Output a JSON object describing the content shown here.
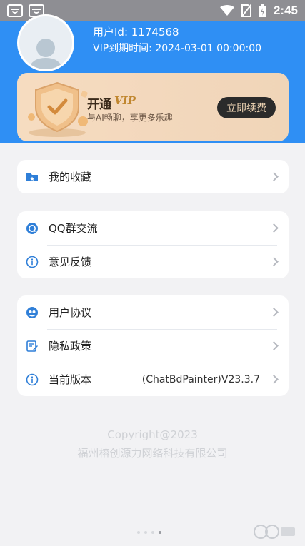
{
  "status_bar": {
    "time": "2:45"
  },
  "user": {
    "id_text": "用户Id: 1174568",
    "vip_expire_text": "VIP到期时间:  2024-03-01 00:00:00"
  },
  "vip_card": {
    "title": "开通",
    "tag": "VIP",
    "subtitle": "与AI畅聊，享更多乐趣",
    "button_label": "立即续费"
  },
  "menu": {
    "group1": [
      {
        "label": "我的收藏",
        "icon": "folder-icon"
      }
    ],
    "group2": [
      {
        "label": "QQ群交流",
        "icon": "qq-icon"
      },
      {
        "label": "意见反馈",
        "icon": "info-icon"
      }
    ],
    "group3": [
      {
        "label": "用户协议",
        "icon": "agreement-icon"
      },
      {
        "label": "隐私政策",
        "icon": "edit-doc-icon"
      },
      {
        "label": "当前版本",
        "icon": "info-icon",
        "value": "(ChatBdPainter)V23.3.7"
      }
    ]
  },
  "footer": {
    "copyright": "Copyright@2023",
    "company": "福州榕创源力网络科技有限公司"
  },
  "colors": {
    "header_blue": "#2f8ff4",
    "icon_blue": "#2f7fd8",
    "vip_gold": "#c0862e",
    "button_dark": "#2b2b2b"
  }
}
